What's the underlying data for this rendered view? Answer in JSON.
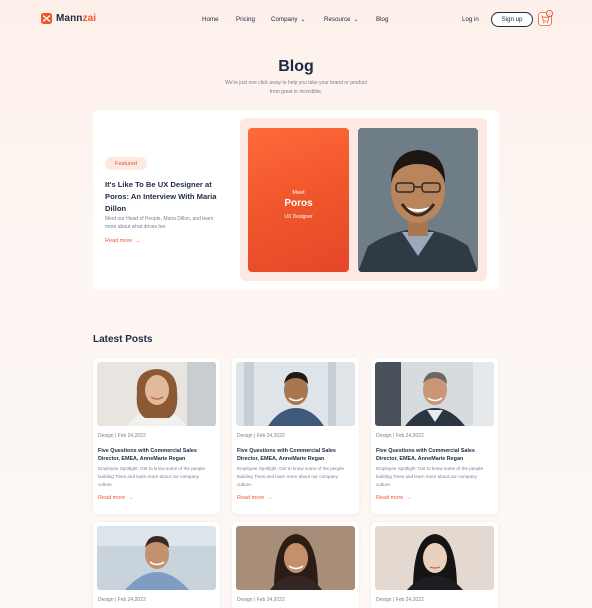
{
  "brand": {
    "name_prefix": "Mann",
    "name_accent": "zai",
    "accent_color": "#f0562b"
  },
  "nav": {
    "items": [
      {
        "label": "Home"
      },
      {
        "label": "Pricing"
      },
      {
        "label": "Company"
      },
      {
        "label": "Resource"
      },
      {
        "label": "Blog"
      }
    ],
    "login_label": "Log in",
    "signup_label": "Sign up",
    "cart_count": "0",
    "cart_icon": "cart-icon"
  },
  "hero": {
    "title": "Blog",
    "subtitle": "We're just one click away to help you take your brand or product from great to incredible."
  },
  "featured": {
    "badge": "Featured",
    "title": "It's Like To Be UX Designer at Poros: An Interview With Maria Dillon",
    "description": "Meet our Head of People, Maria Dillon, and learn more about what drives her.",
    "read_more": "Read more",
    "card_line1": "Meet",
    "card_line2": "Poros",
    "card_line3": "UX Designer"
  },
  "latest": {
    "title": "Latest Posts",
    "posts": [
      {
        "meta": "Design | Feb 24,2022",
        "title": "Five Questions with Commercial Sales Director, EMEA, AnneMarie Regan",
        "desc": "Employee Spotlight: Get to know some of the people building Tines and learn more about our company culture.",
        "read_more": "Read more"
      },
      {
        "meta": "Design | Feb 24,2022",
        "title": "Five Questions with Commercial Sales Director, EMEA, AnneMarie Regan",
        "desc": "Employee Spotlight: Get to know some of the people building Tines and learn more about our company culture.",
        "read_more": "Read more"
      },
      {
        "meta": "Design | Feb 24,2022",
        "title": "Five Questions with Commercial Sales Director, EMEA, AnneMarie Regan",
        "desc": "Employee Spotlight: Get to know some of the people building Tines and learn more about our company culture.",
        "read_more": "Read more"
      },
      {
        "meta": "Design | Feb 24,2022"
      },
      {
        "meta": "Design | Feb 24,2022"
      },
      {
        "meta": "Design | Feb 24,2022"
      }
    ]
  }
}
